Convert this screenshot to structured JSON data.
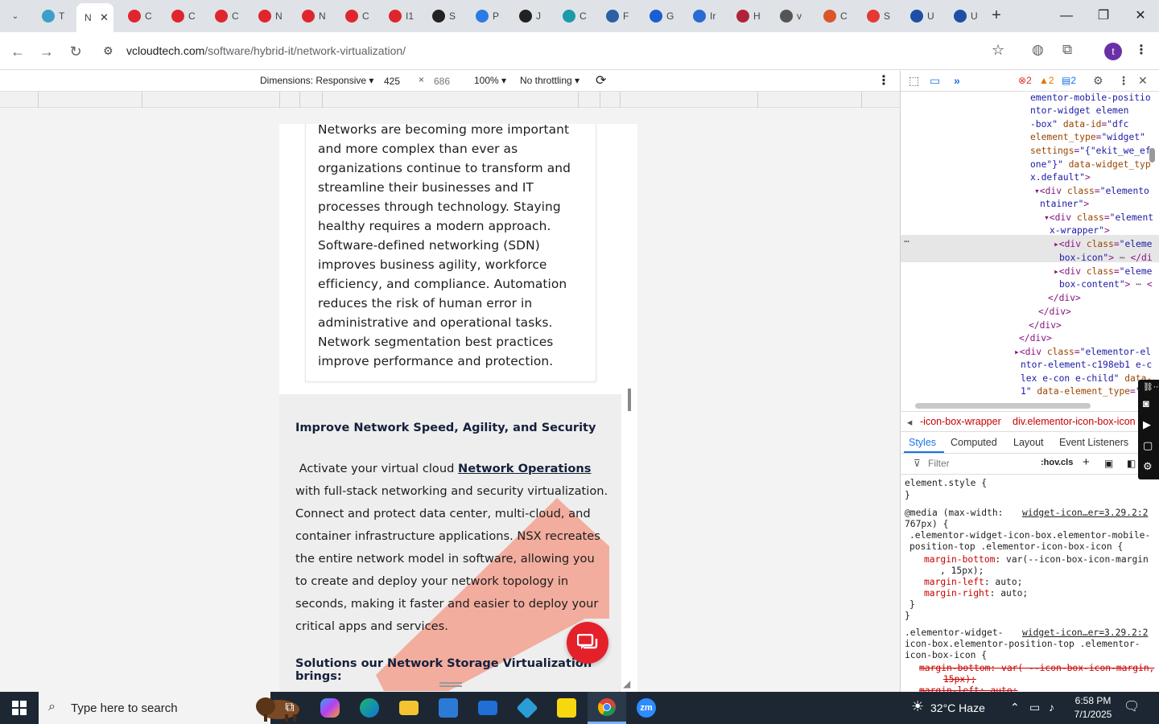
{
  "browser": {
    "tabs": [
      {
        "label": "T",
        "icon": "chrome-icon",
        "color": "#3aa0c9"
      },
      {
        "label": "N",
        "icon": "active-tab",
        "color": "#ffffff",
        "active": true
      },
      {
        "label": "C",
        "icon": "cloud-icon",
        "color": "#e0262d"
      },
      {
        "label": "C",
        "icon": "cloud-icon",
        "color": "#e0262d"
      },
      {
        "label": "C",
        "icon": "cloud-icon",
        "color": "#e0262d"
      },
      {
        "label": "N",
        "icon": "cloud-icon",
        "color": "#e0262d"
      },
      {
        "label": "N",
        "icon": "cloud-icon",
        "color": "#e0262d"
      },
      {
        "label": "C",
        "icon": "cloud-icon",
        "color": "#e0262d"
      },
      {
        "label": "I1",
        "icon": "cloud-icon",
        "color": "#e0262d"
      },
      {
        "label": "S",
        "icon": "gear-icon",
        "color": "#222222"
      },
      {
        "label": "P",
        "icon": "wave-icon",
        "color": "#2c7be5"
      },
      {
        "label": "J",
        "icon": "openai-icon",
        "color": "#222222"
      },
      {
        "label": "C",
        "icon": "c-icon",
        "color": "#1b9aaa"
      },
      {
        "label": "F",
        "icon": "scale-icon",
        "color": "#2d5fa3"
      },
      {
        "label": "G",
        "icon": "x-icon",
        "color": "#1a5fd0"
      },
      {
        "label": "Ir",
        "icon": "check-icon",
        "color": "#2a6bd1"
      },
      {
        "label": "H",
        "icon": "dumbbell-icon",
        "color": "#b0233b"
      },
      {
        "label": "v",
        "icon": "globe-icon",
        "color": "#555555"
      },
      {
        "label": "C",
        "icon": "swoosh-icon",
        "color": "#d9562b"
      },
      {
        "label": "S",
        "icon": "o-icon",
        "color": "#e53935"
      },
      {
        "label": "U",
        "icon": "doc-icon",
        "color": "#1e4fa5"
      },
      {
        "label": "U",
        "icon": "doc-icon",
        "color": "#1e4fa5"
      }
    ],
    "new_tab": "+",
    "window": {
      "minimize": "—",
      "restore": "❐",
      "close": "✕"
    },
    "url_host": "vcloudtech.com",
    "url_path": "/software/hybrid-it/network-virtualization/"
  },
  "device_toolbar": {
    "dimensions_label": "Dimensions: Responsive",
    "width": "425",
    "times": "×",
    "height": "686",
    "zoom": "100%",
    "throttling": "No throttling"
  },
  "page": {
    "card_text": "Networks are becoming more important and more complex than ever as organizations continue to transform and streamline their businesses and IT processes through technology. Staying healthy requires a modern approach. Software-defined networking (SDN) improves business agility, workforce efficiency, and compliance. Automation reduces the risk of human error in administrative and operational tasks. Network segmentation best practices improve performance and protection.",
    "section_title": "Improve Network Speed, Agility, and Security",
    "section_intro": "Activate your virtual cloud ",
    "section_link": "Network Operations",
    "section_rest": " with full-stack networking and security virtualization. Connect and protect data center, multi-cloud, and container infrastructure applications. NSX recreates the entire network model in software, allowing you to create and deploy your network topology in seconds, making it faster and easier to deploy your critical apps and services.",
    "section_title2": "Solutions our Network Storage Virtualization brings:",
    "accent_color": "#e4212a"
  },
  "devtools": {
    "errors": "2",
    "warnings": "2",
    "info": "2",
    "crumb_1": "-icon-box-wrapper",
    "crumb_2": "div.elementor-icon-box-icon",
    "subtabs": {
      "styles": "Styles",
      "computed": "Computed",
      "layout": "Layout",
      "events": "Event Listeners"
    },
    "filter_placeholder": "Filter",
    "hov": ":hov",
    "cls": ".cls",
    "element_style": "element.style {",
    "media_query": "@media (max-width:",
    "media_query2": "767px) {",
    "source_1": "widget-icon…er=3.29.2:2",
    "source_2": "widget-icon…er=3.29.2:2",
    "selector_1": ".elementor-widget-icon-box.elementor-mobile-",
    "selector_1b": "position-top .elementor-icon-box-icon {",
    "rule_1a": "margin-bottom",
    "rule_1a_val": ": var(--icon-box-icon-margin",
    "rule_1a_val2": ", 15px);",
    "rule_1b": "margin-left",
    "rule_1b_val": ": auto;",
    "rule_1c": "margin-right",
    "rule_1c_val": ": auto;",
    "selector_2": ".elementor-widget-",
    "selector_2b": "icon-box.elementor-position-top .elementor-",
    "selector_2c": "icon-box-icon {",
    "rule_2a": "margin-bottom: var( --icon-box-icon-margin,",
    "rule_2a2": "15px);",
    "rule_2b": "margin-left: auto;"
  },
  "taskbar": {
    "search_placeholder": "Type here to search",
    "weather": "32°C  Haze",
    "time": "6:58 PM",
    "date": "7/1/2025",
    "notifications": "1"
  }
}
